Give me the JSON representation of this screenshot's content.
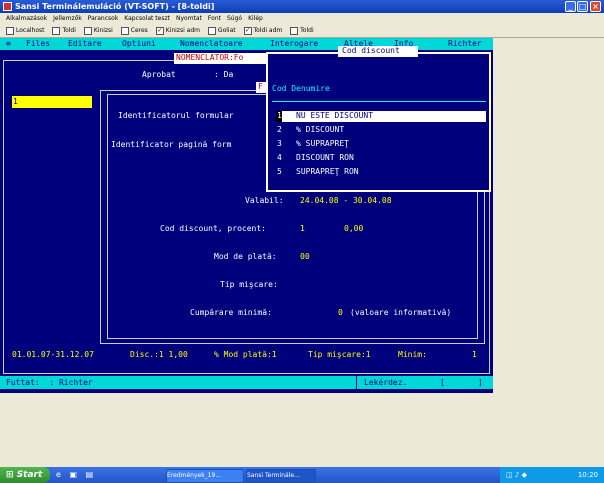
{
  "window": {
    "title": "Sansi Terminálemuláció (VT-SOFT) - [8-toldi]"
  },
  "menubar": [
    "Alkalmazások",
    "Jellemzők",
    "Parancsok",
    "Kapcsolat teszt",
    "Nyomtat",
    "Font",
    "Súgó",
    "Kilép"
  ],
  "toolbar": {
    "items": [
      {
        "label": "Localhost",
        "checked": false
      },
      {
        "label": "Toldi",
        "checked": false
      },
      {
        "label": "Kinizsi",
        "checked": false
      },
      {
        "label": "Ceres",
        "checked": false
      },
      {
        "label": "Kinizsi adm",
        "checked": true
      },
      {
        "label": "Goliat",
        "checked": false
      },
      {
        "label": "Toldi adm",
        "checked": true
      },
      {
        "label": "Toldi",
        "checked": false
      }
    ]
  },
  "terminal": {
    "menu_marker": "≡",
    "menu": [
      "Files",
      "Editare",
      "Optiuni",
      "Nomenclatoare",
      "Interogare",
      "Altele",
      "Info"
    ],
    "user_right": "Richter",
    "left_field": "1",
    "aprobat_label": "Aprobat",
    "aprobat_value": ": Da",
    "nomenclator_title": "NOMENCLATOR:Fo",
    "f_marker": "F",
    "identificatorul_formular": "Identificatorul formular",
    "identificator_pagina": "Identificator pagină form",
    "valabil_label": "Valabil:",
    "valabil_value": "24.04.08 - 30.04.08",
    "cod_discount_label": "Cod discount, procent:",
    "cod_discount_code": "1",
    "cod_discount_percent": "0,00",
    "mod_plata_label": "Mod de plată:",
    "mod_plata_value": "00",
    "tip_miscare_label": "Tip mişcare:",
    "cumparare_minima_label": "Cumpărare minimă:",
    "cumparare_minima_value": "0",
    "cumparare_minima_note": "(valoare informativă)",
    "info_line": {
      "period": "01.01.07-31.12.07",
      "disc": "Disc.:1 1,00",
      "mod_plata": "% Mod plată:1",
      "tip_miscare": "Tip mişcare:1",
      "minim": "Minim:",
      "minim_value": "1"
    },
    "status": {
      "futtat": "Futtat:  : Richter",
      "lekerdez": "Lekérdez.",
      "bracket_open": "[",
      "bracket_close": "]"
    }
  },
  "popup": {
    "title": "Cod discount",
    "header": "Cod Denumire",
    "options": [
      {
        "code": "1",
        "label": "NU ESTE DISCOUNT",
        "selected": true
      },
      {
        "code": "2",
        "label": "% DISCOUNT",
        "selected": false
      },
      {
        "code": "3",
        "label": "% SUPRAPREŢ",
        "selected": false
      },
      {
        "code": "4",
        "label": "DISCOUNT RON",
        "selected": false
      },
      {
        "code": "5",
        "label": "SUPRAPREŢ RON",
        "selected": false
      }
    ]
  },
  "taskbar": {
    "start": "Start",
    "tasks": [
      "Eredmények_19...",
      "Sansi Terminále..."
    ],
    "clock": "10:20"
  }
}
